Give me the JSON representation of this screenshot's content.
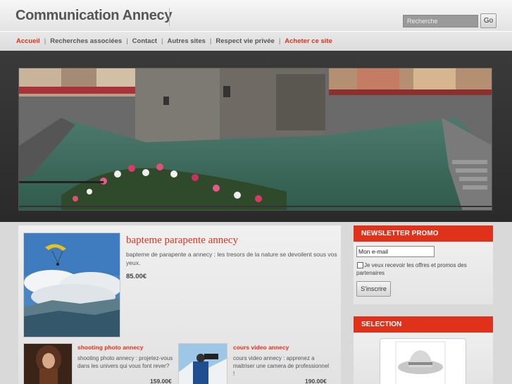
{
  "header": {
    "site_title": "Communication Annecy",
    "search_placeholder": "Recherche",
    "go_label": "Go"
  },
  "nav": {
    "items": [
      {
        "label": "Accueil",
        "active": true
      },
      {
        "label": "Recherches associées",
        "active": false
      },
      {
        "label": "Contact",
        "active": false
      },
      {
        "label": "Autres sites",
        "active": false
      },
      {
        "label": "Respect vie privée",
        "active": false
      },
      {
        "label": "Acheter ce site",
        "active": true
      }
    ]
  },
  "featured": {
    "title": "bapteme parapente annecy",
    "description": "bapteme de parapente a annecy : les tresors de la nature se devoilent sous vos yeux.",
    "price": "85.00€"
  },
  "products": [
    {
      "title": "shooting photo annecy",
      "description": "shooting photo annecy : projetez-vous dans les univers qui vous font rever?",
      "price": "159.00€"
    },
    {
      "title": "cours video annecy",
      "description": "cours video annecy : apprenez a maitriser une camera de professionnel !",
      "price": "190.00€"
    }
  ],
  "newsletter": {
    "heading": "NEWSLETTER PROMO",
    "email_value": "Mon e-mail",
    "optin_label": "Je veux recevoir les offres et promos des partenaires",
    "subscribe_label": "S'inscrire"
  },
  "selection": {
    "heading": "SELECTION"
  },
  "colors": {
    "accent": "#e0321b",
    "title": "#555555"
  }
}
